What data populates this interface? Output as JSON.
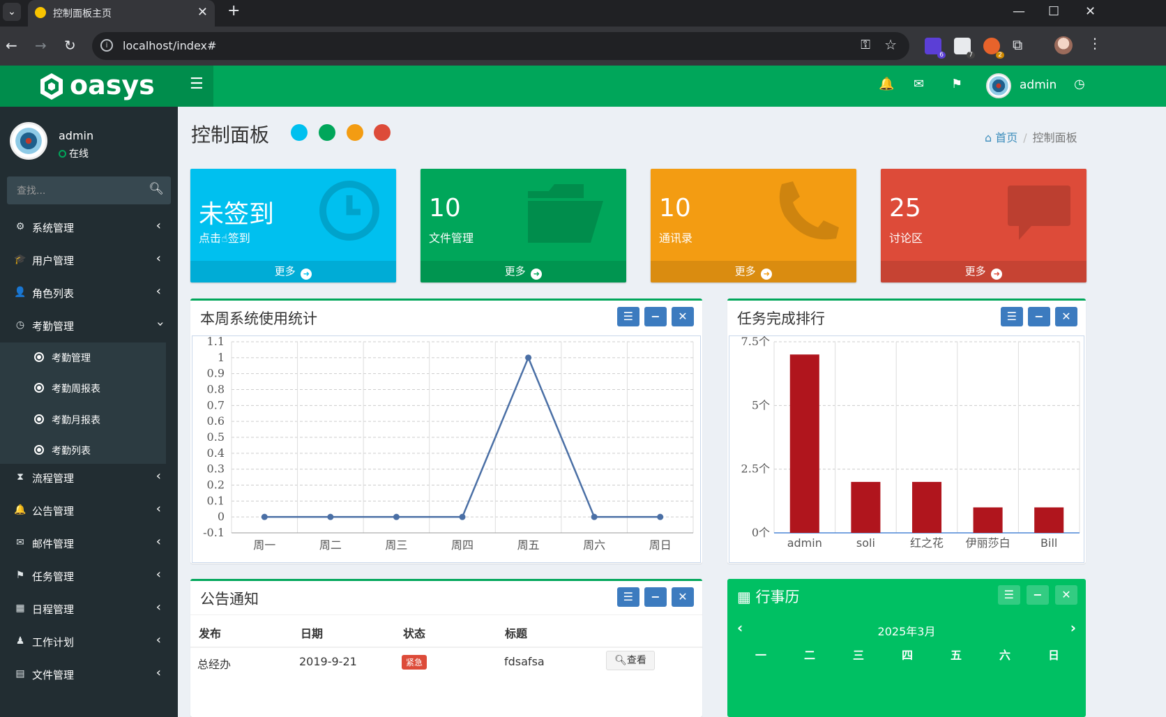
{
  "browser": {
    "tab_title": "控制面板主页",
    "url": "localhost/index#",
    "extensions": [
      {
        "name": "extension-1",
        "badge": "6",
        "color": "#5b3fd6"
      },
      {
        "name": "extension-2",
        "badge": "7",
        "color": "#e8eaed"
      },
      {
        "name": "extension-3",
        "badge": "2",
        "color": "#e8632b"
      }
    ]
  },
  "header": {
    "logo": "oasys",
    "username": "admin"
  },
  "sidebar": {
    "user_name": "admin",
    "user_status": "在线",
    "search_placeholder": "查找...",
    "items": [
      {
        "label": "系统管理",
        "icon": "⚙"
      },
      {
        "label": "用户管理",
        "icon": "🎓"
      },
      {
        "label": "角色列表",
        "icon": "👤"
      },
      {
        "label": "考勤管理",
        "icon": "◷"
      },
      {
        "label": "流程管理",
        "icon": "⧗"
      },
      {
        "label": "公告管理",
        "icon": "🔔"
      },
      {
        "label": "邮件管理",
        "icon": "✉"
      },
      {
        "label": "任务管理",
        "icon": "⚑"
      },
      {
        "label": "日程管理",
        "icon": "▦"
      },
      {
        "label": "工作计划",
        "icon": "♟"
      },
      {
        "label": "文件管理",
        "icon": "▤"
      }
    ],
    "subitems": [
      "考勤管理",
      "考勤周报表",
      "考勤月报表",
      "考勤列表"
    ]
  },
  "content": {
    "page_title": "控制面板",
    "skin_colors": [
      "#00c0ef",
      "#00a65a",
      "#f39c12",
      "#dd4b39"
    ],
    "breadcrumb": {
      "home": "首页",
      "current": "控制面板"
    }
  },
  "stat_boxes": [
    {
      "value": "未签到",
      "label": "点击☝签到",
      "footer": "更多",
      "color": "#00c0ef"
    },
    {
      "value": "10",
      "label": "文件管理",
      "footer": "更多",
      "color": "#00a65a"
    },
    {
      "value": "10",
      "label": "通讯录",
      "footer": "更多",
      "color": "#f39c12"
    },
    {
      "value": "25",
      "label": "讨论区",
      "footer": "更多",
      "color": "#dd4b39"
    }
  ],
  "usage_box": {
    "title": "本周系统使用统计"
  },
  "rank_box": {
    "title": "任务完成排行"
  },
  "notice_box": {
    "title": "公告通知",
    "columns": [
      "发布",
      "日期",
      "状态",
      "标题"
    ],
    "rows": [
      {
        "publisher": "总经办",
        "date": "2019-9-21",
        "status": "紧急",
        "title": "fdsafsa",
        "action": "查看"
      }
    ]
  },
  "calendar_box": {
    "title": "行事历",
    "month": "2025年3月",
    "weekdays": [
      "一",
      "二",
      "三",
      "四",
      "五",
      "六",
      "日"
    ]
  },
  "chart_data": [
    {
      "type": "line",
      "title": "本周系统使用统计",
      "categories": [
        "周一",
        "周二",
        "周三",
        "周四",
        "周五",
        "周六",
        "周日"
      ],
      "values": [
        0,
        0,
        0,
        0,
        1,
        0,
        0
      ],
      "ylim": [
        -0.1,
        1.1
      ],
      "yticks": [
        "1.1",
        "1",
        "0.9",
        "0.8",
        "0.7",
        "0.6",
        "0.5",
        "0.4",
        "0.3",
        "0.2",
        "0.1",
        "0",
        "-0.1"
      ],
      "grid": true,
      "color": "#4a6fa5"
    },
    {
      "type": "bar",
      "title": "任务完成排行",
      "categories": [
        "admin",
        "soli",
        "红之花",
        "伊丽莎白",
        "Bill"
      ],
      "values": [
        7,
        2,
        2,
        1,
        1
      ],
      "ylim": [
        0,
        7.5
      ],
      "yticks": [
        "7.5个",
        "5个",
        "2.5个",
        "0个"
      ],
      "grid": true,
      "color": "#b0151d"
    }
  ]
}
